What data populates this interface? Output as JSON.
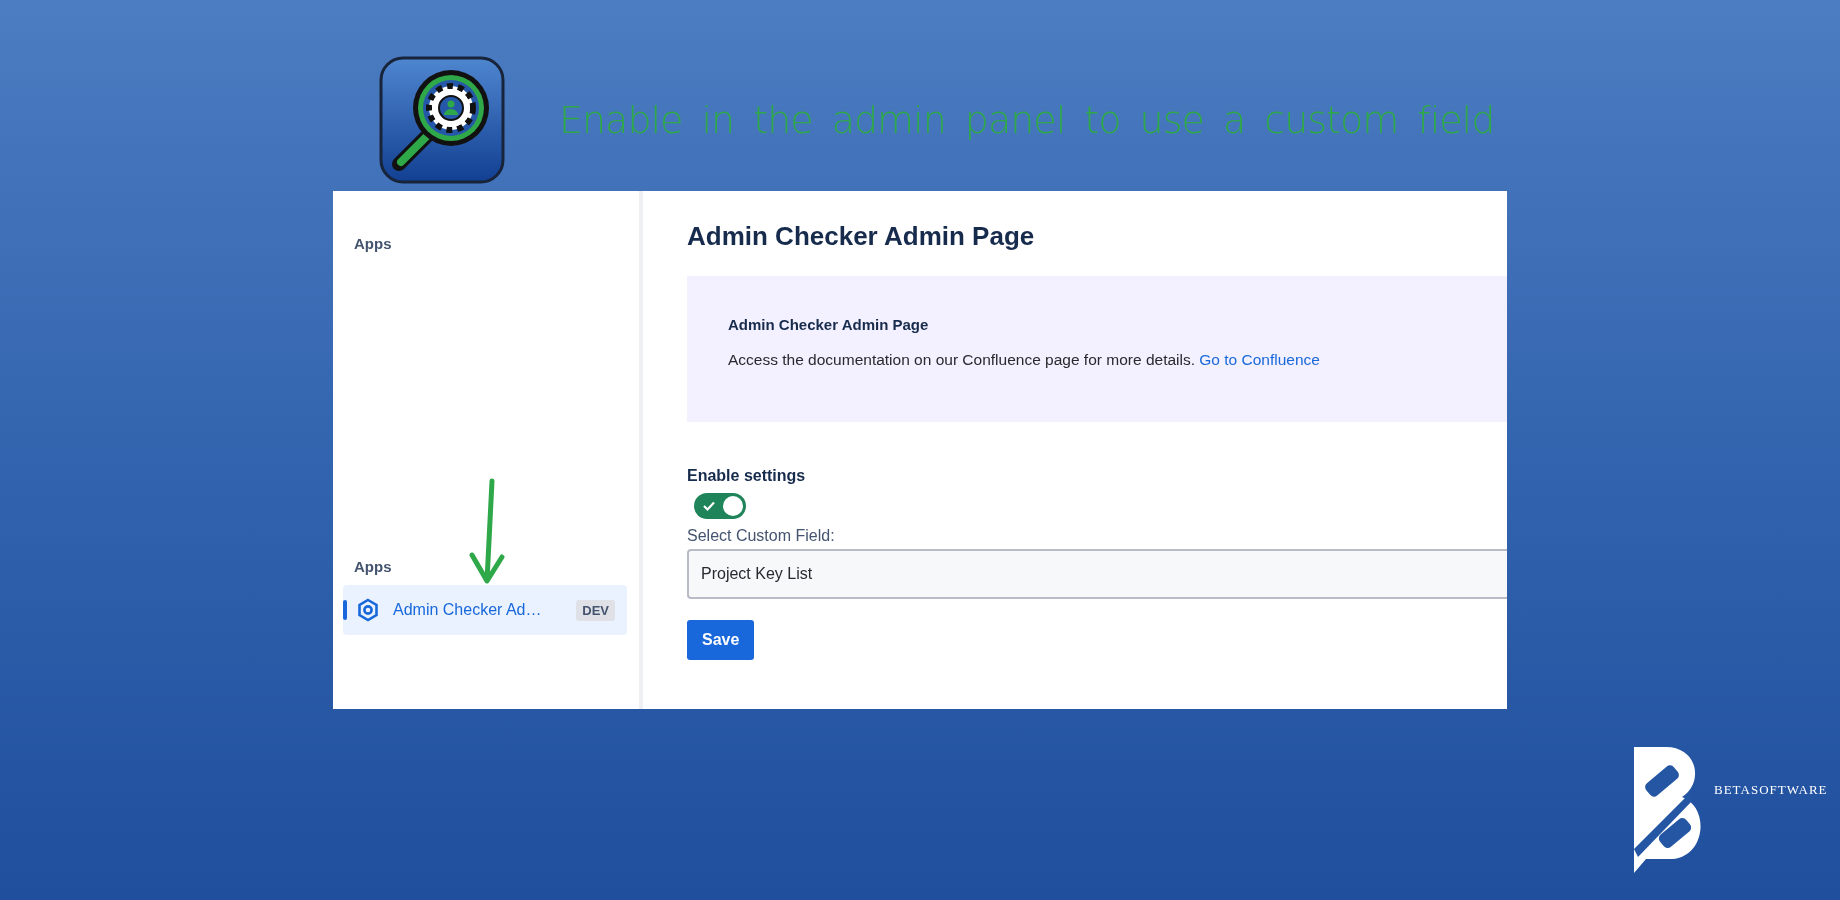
{
  "banner": {
    "title": "Enable in the admin panel to use a custom field"
  },
  "sidebar": {
    "heading": "Apps",
    "section": "Apps",
    "items": [
      {
        "label": "Admin Checker Ad…",
        "badge": "DEV",
        "selected": true
      }
    ]
  },
  "page": {
    "title": "Admin Checker Admin Page",
    "info": {
      "heading": "Admin Checker Admin Page",
      "text": "Access the documentation on our Confluence page for more details.",
      "link": "Go to Confluence"
    },
    "enable": {
      "label": "Enable settings",
      "on": true
    },
    "field": {
      "label": "Select Custom Field:",
      "value": "Project Key List"
    },
    "save": "Save"
  },
  "brand": {
    "name": "BETASOFTWARE"
  }
}
